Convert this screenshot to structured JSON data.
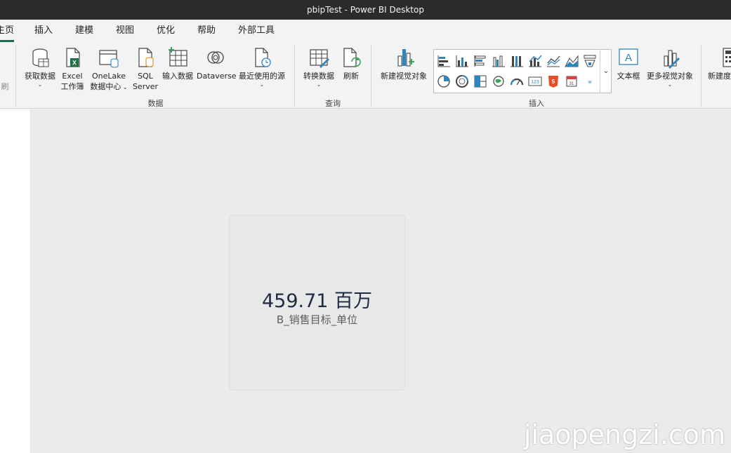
{
  "window": {
    "title": "pbipTest - Power BI Desktop"
  },
  "menu": {
    "tabs": [
      {
        "label": "主页",
        "active": true
      },
      {
        "label": "插入"
      },
      {
        "label": "建模"
      },
      {
        "label": "视图"
      },
      {
        "label": "优化"
      },
      {
        "label": "帮助"
      },
      {
        "label": "外部工具"
      }
    ]
  },
  "ribbon": {
    "left_partial_label": "刷",
    "data_group": {
      "label": "数据",
      "buttons": [
        {
          "label": "获取数据",
          "icon": "database-icon"
        },
        {
          "label": "Excel",
          "label2": "工作簿",
          "icon": "excel-icon"
        },
        {
          "label": "OneLake",
          "label2": "数据中心",
          "icon": "onelake-icon"
        },
        {
          "label": "SQL",
          "label2": "Server",
          "icon": "sql-server-icon"
        },
        {
          "label": "输入数据",
          "icon": "table-grid-icon"
        },
        {
          "label": "Dataverse",
          "icon": "dataverse-icon"
        },
        {
          "label": "最近使用的源",
          "icon": "recent-sources-icon"
        }
      ]
    },
    "query_group": {
      "label": "查询",
      "buttons": [
        {
          "label": "转换数据",
          "icon": "transform-data-icon"
        },
        {
          "label": "刷新",
          "icon": "refresh-icon"
        }
      ]
    },
    "insert_group": {
      "label": "插入",
      "new_visual": "新建视觉对象",
      "text_box": "文本框",
      "more_visuals": "更多视觉对象",
      "new_partial": "新建度"
    }
  },
  "card": {
    "value": "459.71 百万",
    "label": "B_销售目标_单位"
  },
  "watermark": "jiaopengzi.com",
  "colors": {
    "accent": "#1d6a52",
    "titlebar": "#2b2b2b",
    "card_value": "#1f2a44"
  }
}
